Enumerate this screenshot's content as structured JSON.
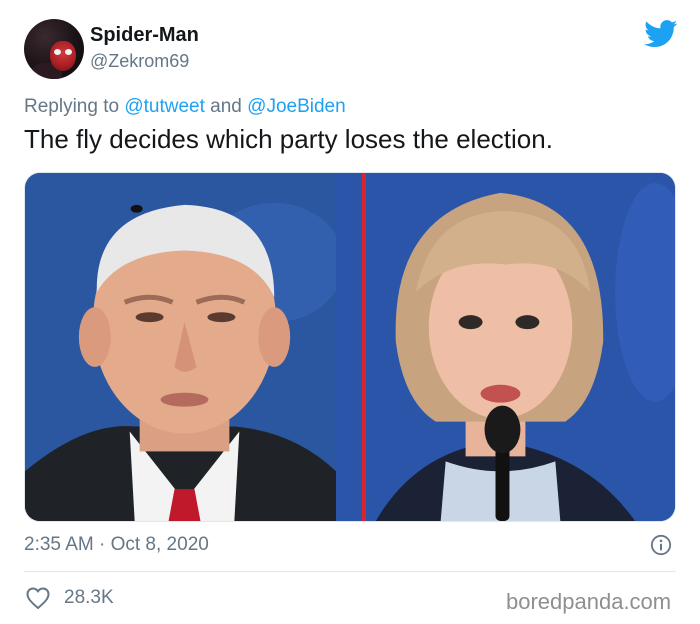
{
  "tweet": {
    "author_name": "Spider-Man",
    "author_handle": "@Zekrom69",
    "reply_prefix": "Replying to",
    "reply_mention_1": "@tutweet",
    "reply_conjunction": "and",
    "reply_mention_2": "@JoeBiden",
    "text": "The fly decides which party loses the election.",
    "timestamp": "2:35 AM · Oct 8, 2020",
    "likes": "28.3K"
  },
  "watermark": "boredpanda.com",
  "icons": {
    "brand": "twitter-bird-icon",
    "info": "info-icon",
    "like": "heart-icon"
  },
  "colors": {
    "brand_blue": "#1da1f2",
    "muted_text": "#657786",
    "primary_text": "#14171a"
  }
}
